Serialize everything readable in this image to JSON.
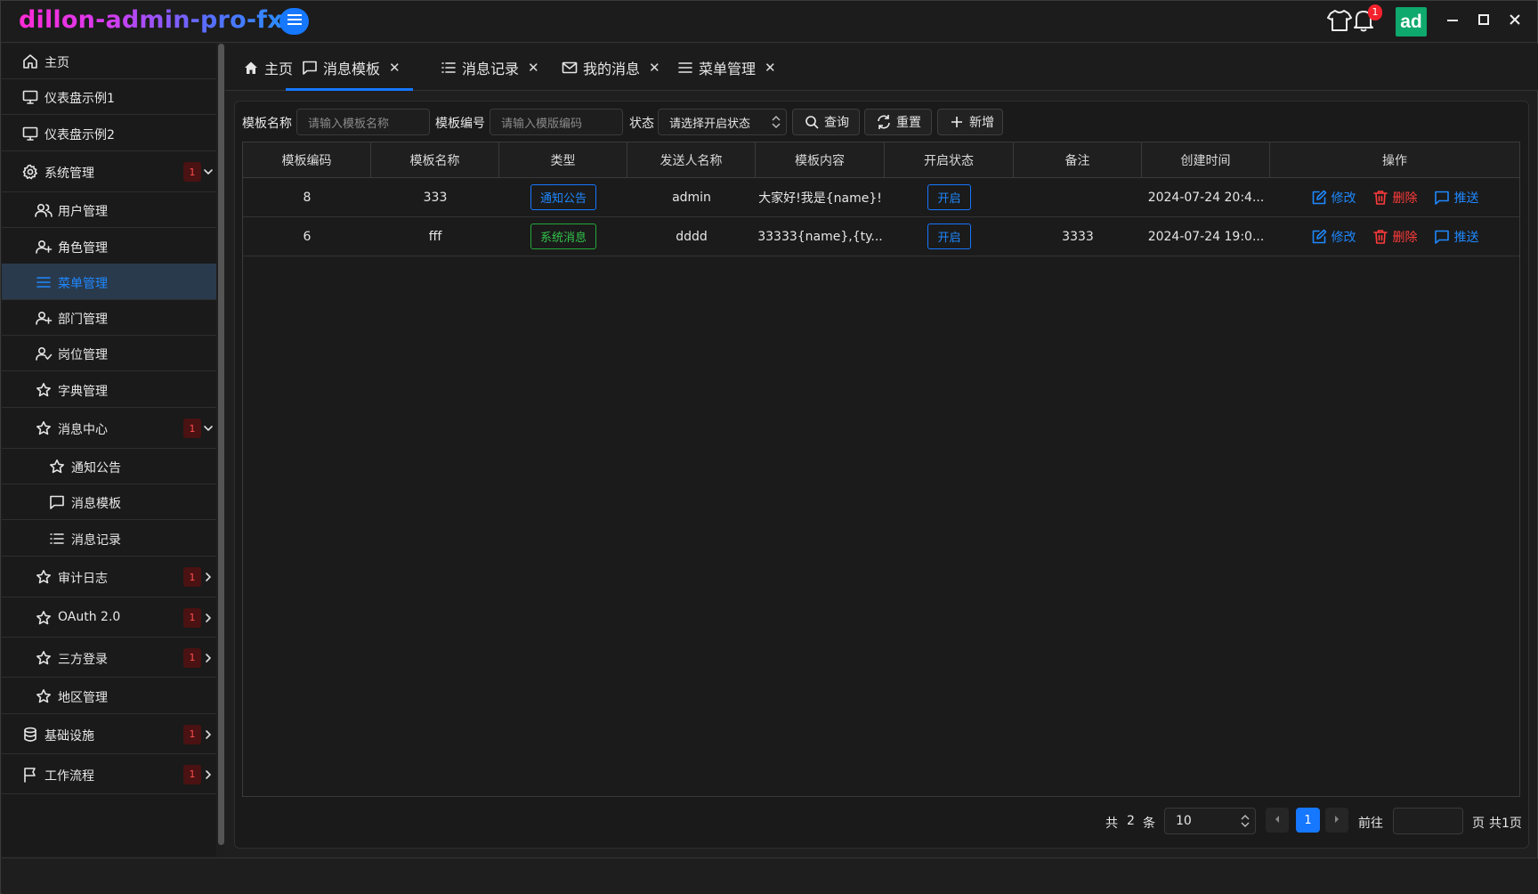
{
  "app": {
    "title": "dillon-admin-pro-fx",
    "notification_count": "1",
    "avatar_text": "ad"
  },
  "sidebar": {
    "items": [
      {
        "label": "主页",
        "icon": "home-icon"
      },
      {
        "label": "仪表盘示例1",
        "icon": "monitor-icon"
      },
      {
        "label": "仪表盘示例2",
        "icon": "monitor-icon"
      },
      {
        "label": "系统管理",
        "icon": "gear-icon",
        "badge": "1",
        "expanded": true
      },
      {
        "label": "用户管理",
        "icon": "users-icon"
      },
      {
        "label": "角色管理",
        "icon": "user-add-icon"
      },
      {
        "label": "菜单管理",
        "icon": "menu-icon",
        "active": true
      },
      {
        "label": "部门管理",
        "icon": "user-add-icon"
      },
      {
        "label": "岗位管理",
        "icon": "user-check-icon"
      },
      {
        "label": "字典管理",
        "icon": "star-icon"
      },
      {
        "label": "消息中心",
        "icon": "star-icon",
        "badge": "1",
        "expanded": true
      },
      {
        "label": "通知公告",
        "icon": "star-icon"
      },
      {
        "label": "消息模板",
        "icon": "message-icon"
      },
      {
        "label": "消息记录",
        "icon": "list-icon"
      },
      {
        "label": "审计日志",
        "icon": "star-icon",
        "badge": "1"
      },
      {
        "label": "OAuth 2.0",
        "icon": "star-icon",
        "badge": "1"
      },
      {
        "label": "三方登录",
        "icon": "star-icon",
        "badge": "1"
      },
      {
        "label": "地区管理",
        "icon": "star-icon"
      },
      {
        "label": "基础设施",
        "icon": "database-icon",
        "badge": "1"
      },
      {
        "label": "工作流程",
        "icon": "flag-icon",
        "badge": "1"
      }
    ]
  },
  "tabs": [
    {
      "label": "主页",
      "icon": "home-icon",
      "closable": false
    },
    {
      "label": "消息模板",
      "icon": "message-icon",
      "closable": true,
      "active": true
    },
    {
      "label": "消息记录",
      "icon": "list-icon",
      "closable": true
    },
    {
      "label": "我的消息",
      "icon": "mail-icon",
      "closable": true
    },
    {
      "label": "菜单管理",
      "icon": "menu-icon",
      "closable": true
    }
  ],
  "filters": {
    "name_label": "模板名称",
    "name_placeholder": "请输入模板名称",
    "code_label": "模板编号",
    "code_placeholder": "请输入模版编码",
    "status_label": "状态",
    "status_placeholder": "请选择开启状态",
    "query_label": "查询",
    "reset_label": "重置",
    "add_label": "新增"
  },
  "table": {
    "columns": [
      "模板编码",
      "模板名称",
      "类型",
      "发送人名称",
      "模板内容",
      "开启状态",
      "备注",
      "创建时间",
      "操作"
    ],
    "rows": [
      {
        "code": "8",
        "name": "333",
        "type": "通知公告",
        "type_color": "#1677ff",
        "sender": "admin",
        "content": "大家好!我是{name}!",
        "status": "开启",
        "remark": "",
        "created": "2024-07-24 20:4..."
      },
      {
        "code": "6",
        "name": "fff",
        "type": "系统消息",
        "type_color": "#22a83a",
        "sender": "dddd",
        "content": "33333{name},{ty...",
        "status": "开启",
        "remark": "3333",
        "created": "2024-07-24 19:0..."
      }
    ],
    "actions": {
      "edit": "修改",
      "delete": "删除",
      "push": "推送"
    }
  },
  "pagination": {
    "total_prefix": "共",
    "total": "2",
    "total_suffix": "条",
    "page_size": "10",
    "current_page": "1",
    "goto_label": "前往",
    "page_suffix": "页",
    "total_pages_text": "共1页"
  },
  "colors": {
    "accent": "#1677ff",
    "danger": "#ff3b3b",
    "success": "#22a83a",
    "avatar": "#0fa86d"
  }
}
